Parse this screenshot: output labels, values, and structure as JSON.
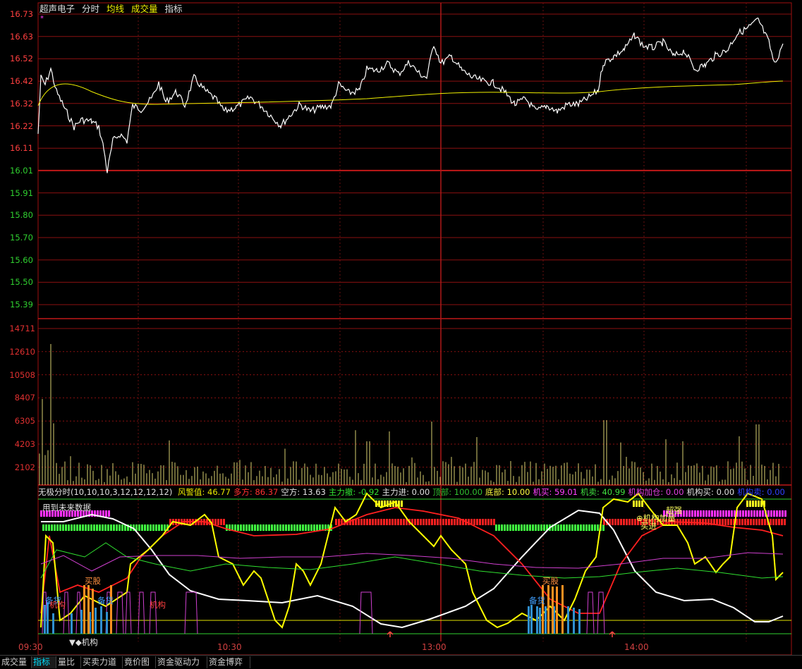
{
  "header": {
    "stock_name": "超声电子",
    "mode": "分时",
    "avg_label": "均线",
    "vol_label": "成交量",
    "indicator_label": "指标",
    "star": "*"
  },
  "price_axis": [
    "16.73",
    "16.63",
    "16.52",
    "16.42",
    "16.32",
    "16.22",
    "16.11",
    "16.01",
    "15.91",
    "15.80",
    "15.70",
    "15.60",
    "15.50",
    "15.39"
  ],
  "volume_axis": [
    "14711",
    "12610",
    "10508",
    "8407",
    "6305",
    "4203",
    "2102"
  ],
  "time_axis": [
    "09:30",
    "10:30",
    "13:00",
    "14:00"
  ],
  "indicator": {
    "name": "无极分时(10,10,10,3,12,12,12,12)",
    "items": [
      {
        "label": "风警值:",
        "value": "46.77",
        "color": "#e8e800"
      },
      {
        "label": "多方:",
        "value": "86.37",
        "color": "#ff3030"
      },
      {
        "label": "空方:",
        "value": "13.63",
        "color": "#e0e0e0"
      },
      {
        "label": "主力撤:",
        "value": "-0.92",
        "color": "#30e030"
      },
      {
        "label": "主力进:",
        "value": "0.00",
        "color": "#e0e0e0"
      },
      {
        "label": "顶部:",
        "value": "100.00",
        "color": "#30c030"
      },
      {
        "label": "底部:",
        "value": "10.00",
        "color": "#ffff40"
      },
      {
        "label": "机买:",
        "value": "59.01",
        "color": "#ff40ff"
      },
      {
        "label": "机卖:",
        "value": "40.99",
        "color": "#40e040"
      },
      {
        "label": "机构加仓:",
        "value": "0.00",
        "color": "#e040e0"
      },
      {
        "label": "机构买:",
        "value": "0.00",
        "color": "#e0e0e0"
      },
      {
        "label": "机构卖:",
        "value": "0.00",
        "color": "#3040ff"
      }
    ]
  },
  "marks": {
    "future": "用到未来数据",
    "buy1": "买股",
    "buy2": "买股",
    "prep1": "备货",
    "prep2": "备货",
    "prep3": "备货",
    "inst1": "机构",
    "inst2": "机构",
    "inst3": "▼◆机构",
    "strong": "超强",
    "add": "⊕机构加量",
    "buyin": "买进"
  },
  "tabs": [
    "成交量",
    "指标",
    "量比",
    "买卖力道",
    "竟价图",
    "资金驱动力",
    "资金博弈"
  ],
  "active_tab": 1
}
